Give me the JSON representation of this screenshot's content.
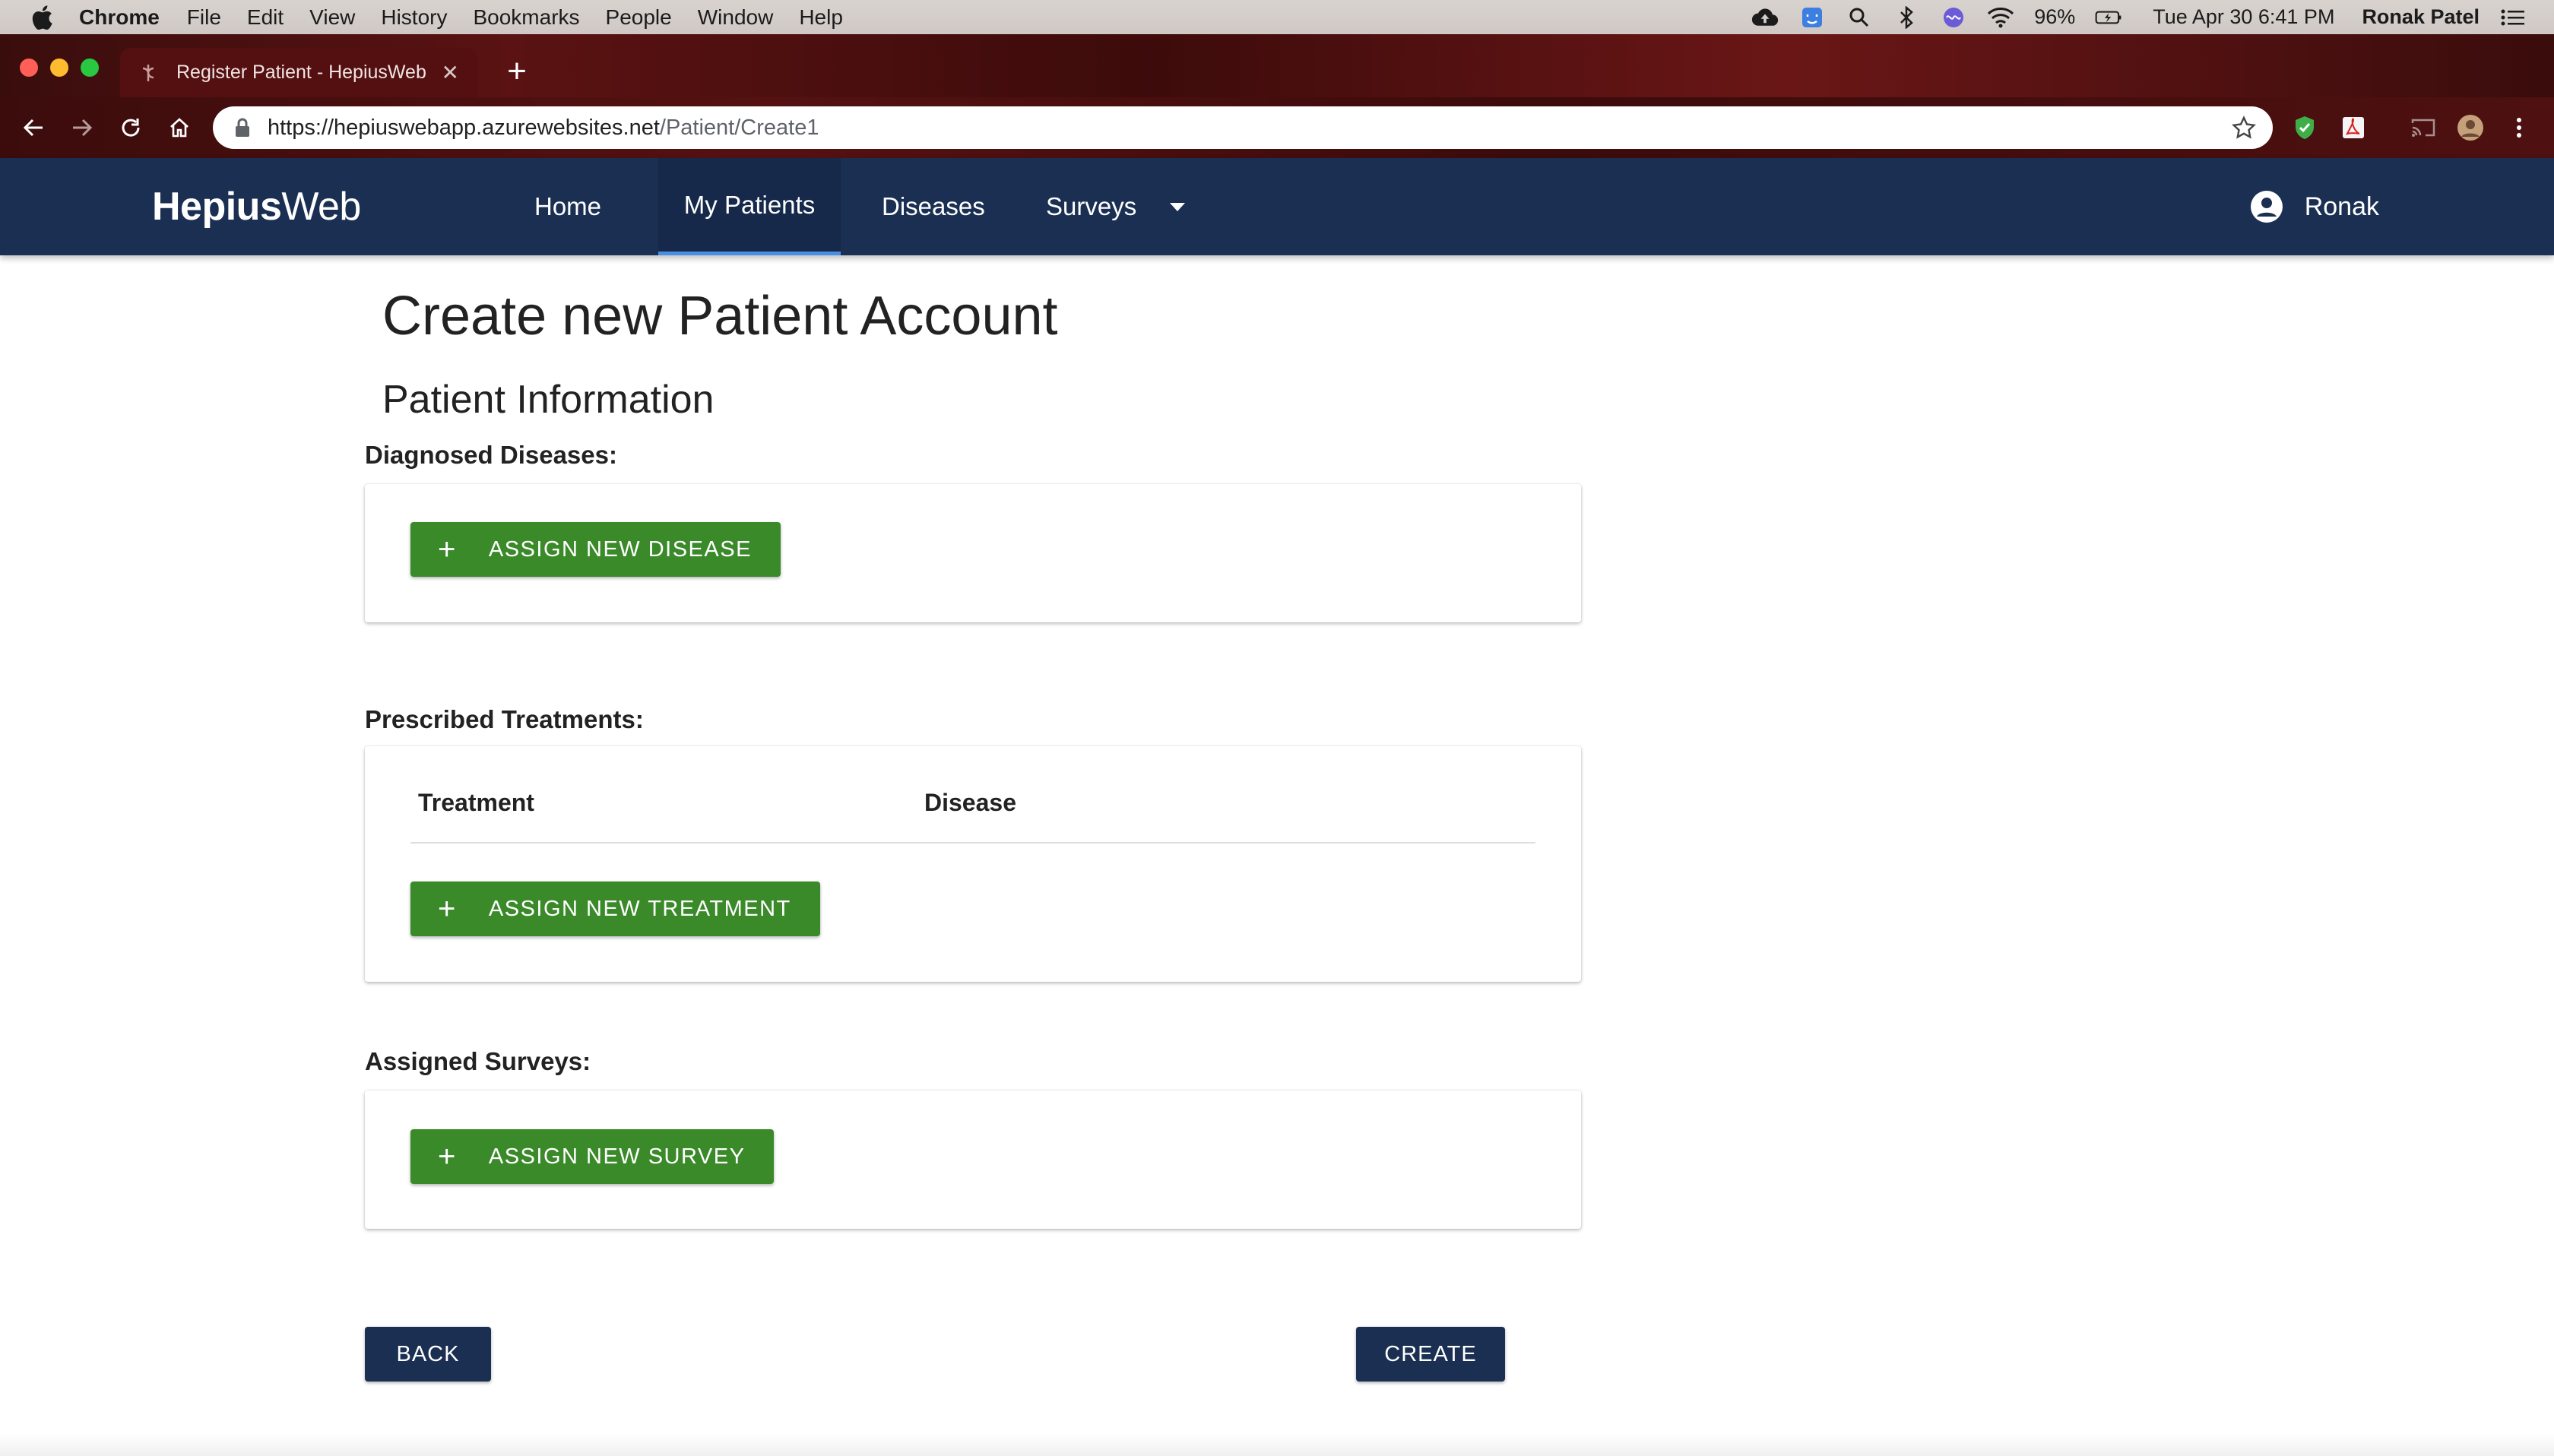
{
  "menubar": {
    "app_name": "Chrome",
    "items": [
      "File",
      "Edit",
      "View",
      "History",
      "Bookmarks",
      "People",
      "Window",
      "Help"
    ],
    "battery": "96%",
    "datetime": "Tue Apr 30  6:41 PM",
    "user": "Ronak Patel"
  },
  "browser": {
    "tab_title": "Register Patient - HepiusWeb",
    "url_host": "https://hepiuswebapp.azurewebsites.net",
    "url_path": "/Patient/Create1"
  },
  "navbar": {
    "brand_bold": "Hepius",
    "brand_light": "Web",
    "links": {
      "home": "Home",
      "my_patients": "My Patients",
      "diseases": "Diseases",
      "surveys": "Surveys"
    },
    "user_name": "Ronak"
  },
  "page": {
    "title": "Create new Patient Account",
    "subtitle": "Patient Information"
  },
  "diseases": {
    "label": "Diagnosed Diseases:",
    "button": "ASSIGN NEW DISEASE"
  },
  "treatments": {
    "label": "Prescribed Treatments:",
    "columns": [
      "Treatment",
      "Disease"
    ],
    "button": "ASSIGN NEW TREATMENT"
  },
  "surveys": {
    "label": "Assigned Surveys:",
    "button": "ASSIGN NEW SURVEY"
  },
  "actions": {
    "back": "BACK",
    "create": "CREATE"
  },
  "colors": {
    "navbar": "#1a2f52",
    "active_tab_underline": "#4a90e2",
    "green_button": "#3a8a2a",
    "dark_button": "#1a2f52"
  }
}
